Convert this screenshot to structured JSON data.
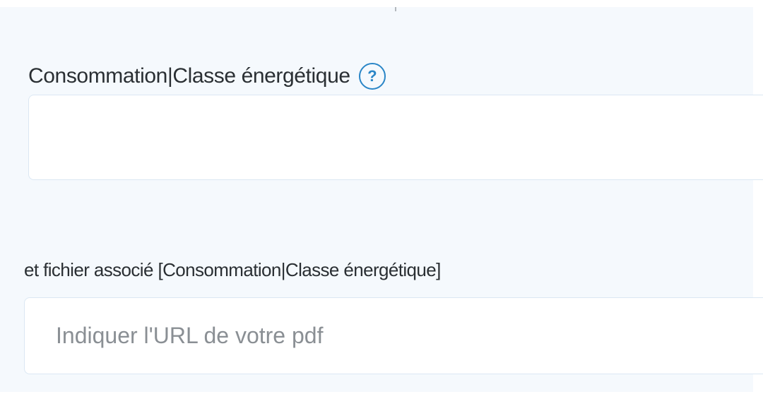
{
  "form": {
    "consumption_field": {
      "label": "Consommation|Classe énergétique",
      "help_glyph": "?",
      "value": ""
    },
    "pdf_field": {
      "label": "et fichier associé [Consommation|Classe énergétique]",
      "placeholder": "Indiquer l'URL de votre pdf",
      "value": ""
    }
  },
  "icons": {
    "help": "question-circle-icon"
  },
  "colors": {
    "panel_background": "#f5f9fd",
    "input_border": "#dbe7f3",
    "help_icon": "#2a86c7",
    "label_text": "#2a2f33",
    "placeholder_text": "#8a8f94"
  }
}
